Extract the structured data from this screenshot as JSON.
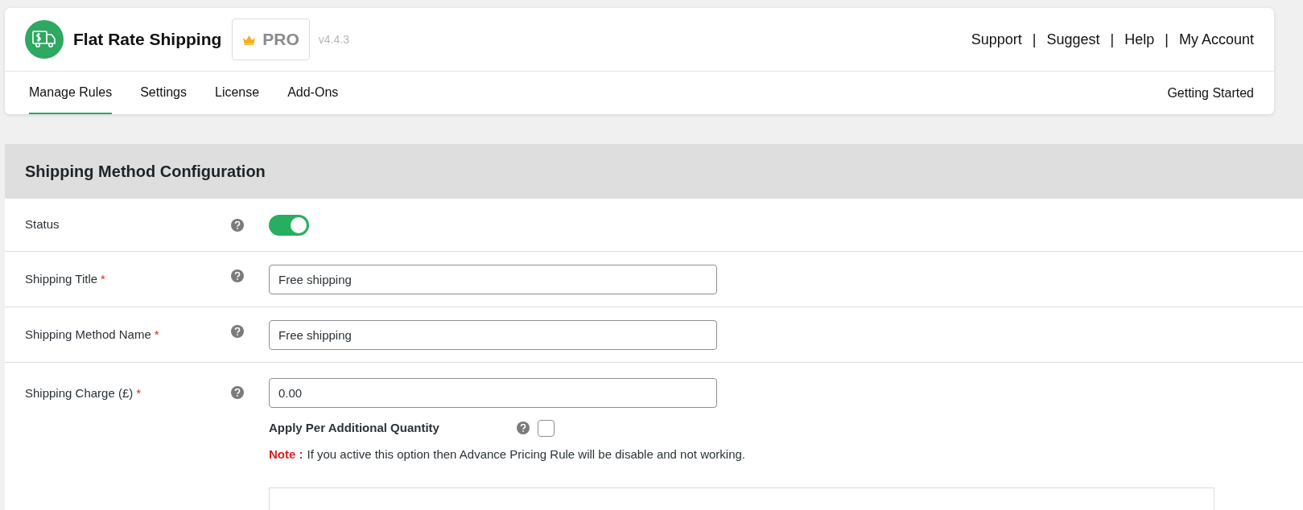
{
  "header": {
    "title": "Flat Rate Shipping",
    "badge": "PRO",
    "version": "v4.4.3",
    "links": [
      "Support",
      "Suggest",
      "Help",
      "My Account"
    ],
    "separator": "|"
  },
  "tabs": [
    {
      "label": "Manage Rules",
      "selected": true
    },
    {
      "label": "Settings",
      "selected": false
    },
    {
      "label": "License",
      "selected": false
    },
    {
      "label": "Add-Ons",
      "selected": false
    }
  ],
  "getting_started": "Getting Started",
  "section": {
    "title": "Shipping Method Configuration",
    "rows": [
      {
        "kind": "toggle",
        "label": "Status",
        "on": true
      },
      {
        "kind": "text",
        "label": "Shipping Title",
        "required_mark": "*",
        "value": "Free shipping"
      },
      {
        "kind": "text",
        "label": "Shipping Method Name",
        "required_mark": "*",
        "value": "Free shipping"
      },
      {
        "kind": "charge",
        "label": "Shipping Charge (£)",
        "required_mark": "*",
        "value": "0.00",
        "option_label": "Apply Per Additional Quantity",
        "checked": false,
        "note_label": "Note :",
        "note_text": "If you active this option then Advance Pricing Rule will be disable and not working."
      }
    ]
  }
}
